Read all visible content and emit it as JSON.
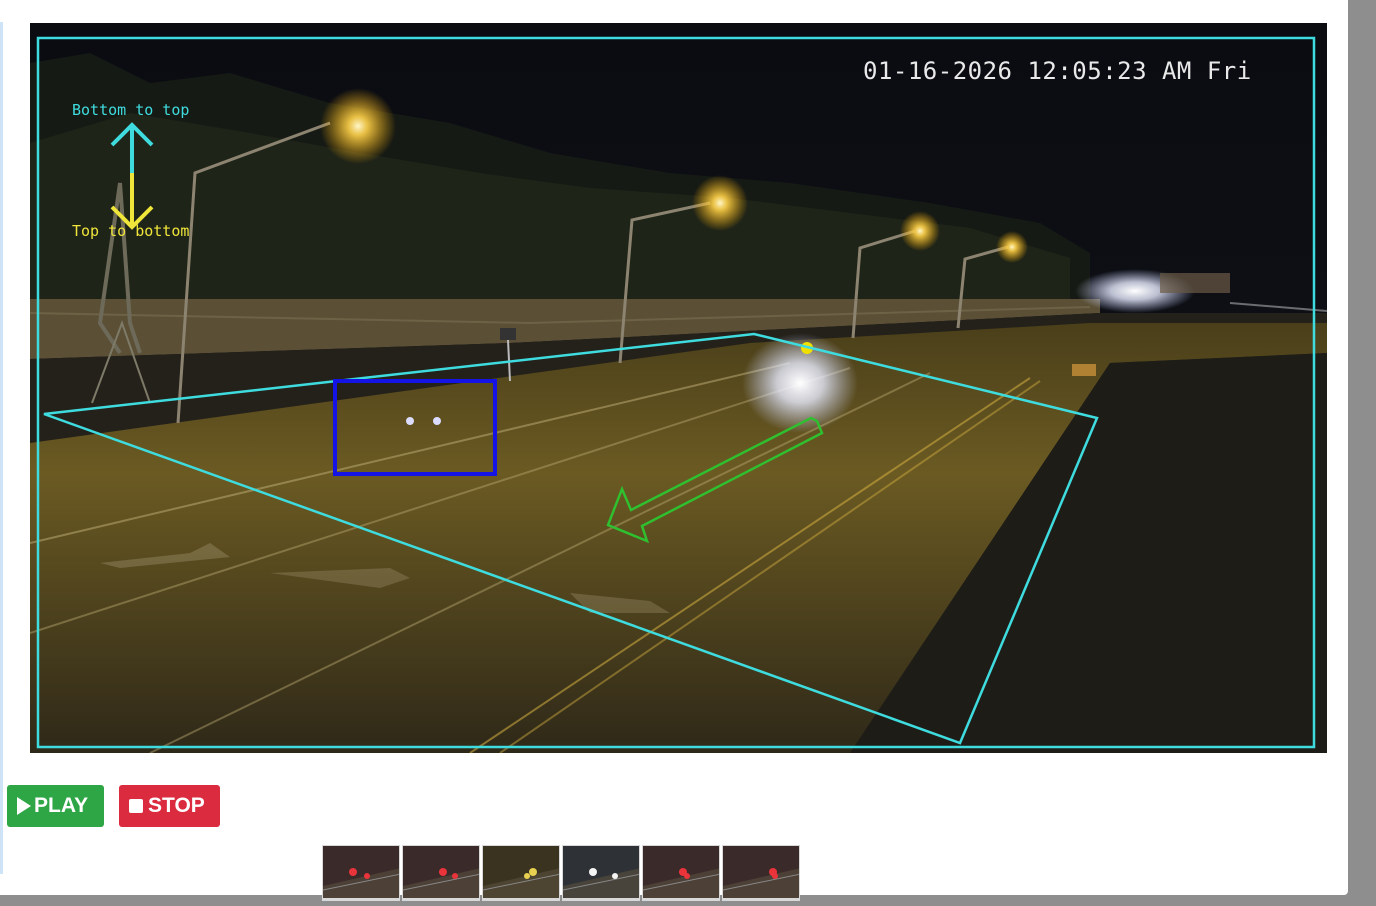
{
  "video": {
    "timestamp": "01-16-2026 12:05:23 AM Fri",
    "direction_labels": {
      "bottom_to_top": "Bottom to top",
      "top_to_bottom": "Top to bottom"
    },
    "colors": {
      "zone_outline": "#3fdcdf",
      "detection_box": "#1414e6",
      "direction_arrow": "#2fbf2f",
      "up_arrow": "#3fdcdf",
      "down_arrow": "#f0e53a"
    }
  },
  "controls": {
    "play_label": "PLAY",
    "stop_label": "STOP",
    "play_icon": "play-triangle",
    "stop_icon": "stop-square",
    "play_color": "#2fa646",
    "stop_color": "#db2b3f"
  },
  "thumbnails": [
    {
      "name": "thumbnail-1",
      "tone": "red"
    },
    {
      "name": "thumbnail-2",
      "tone": "red"
    },
    {
      "name": "thumbnail-3",
      "tone": "yellow"
    },
    {
      "name": "thumbnail-4",
      "tone": "white"
    },
    {
      "name": "thumbnail-5",
      "tone": "red"
    },
    {
      "name": "thumbnail-6",
      "tone": "red"
    }
  ]
}
